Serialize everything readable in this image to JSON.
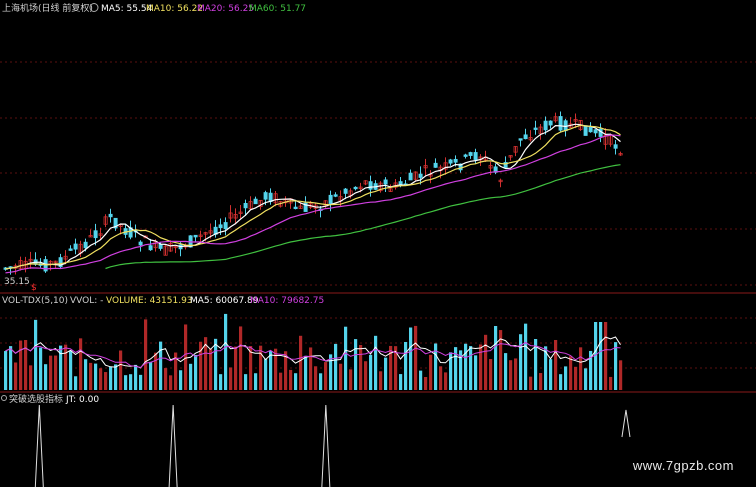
{
  "colors": {
    "up": "#d23030",
    "down": "#54d4ec",
    "ma5": "#ffffff",
    "ma10": "#f0e060",
    "ma20": "#d040e0",
    "ma60": "#40c040",
    "grid": "#5a1010",
    "label": "#d0d0d0"
  },
  "header": {
    "title": "上海机场(日线 前复权)",
    "ma5": "MA5: 55.54",
    "ma10": "MA10: 56.22",
    "ma20": "MA20: 56.25",
    "ma60": "MA60: 51.77"
  },
  "vol_header": {
    "title": "VOL-TDX(5,10)",
    "vvol": "VVOL: -",
    "volume": "VOLUME: 43151.93",
    "ma5": "MA5: 60067.89",
    "ma10": "MA10: 79682.75"
  },
  "ind_header": {
    "title": "突破选股指标",
    "jt": "JT: 0.00"
  },
  "price_low_label": "35.15",
  "marker": "$",
  "watermark": "www.7gpzb.com",
  "chart_data": [
    {
      "type": "candlestick",
      "title": "上海机场(日线 前复权)",
      "series": [
        {
          "name": "MA5"
        },
        {
          "name": "MA10"
        },
        {
          "name": "MA20"
        },
        {
          "name": "MA60"
        }
      ],
      "last_values": {
        "MA5": 55.54,
        "MA10": 56.22,
        "MA20": 56.25,
        "MA60": 51.77
      },
      "low_label": 35.15
    },
    {
      "type": "bar",
      "title": "VOL-TDX(5,10)",
      "last_values": {
        "VOLUME": 43151.93,
        "MA5": 60067.89,
        "MA10": 79682.75
      }
    },
    {
      "type": "line",
      "title": "突破选股指标",
      "last_values": {
        "JT": 0.0
      },
      "signals_at_fraction": [
        0.052,
        0.229,
        0.431,
        0.828
      ]
    }
  ]
}
